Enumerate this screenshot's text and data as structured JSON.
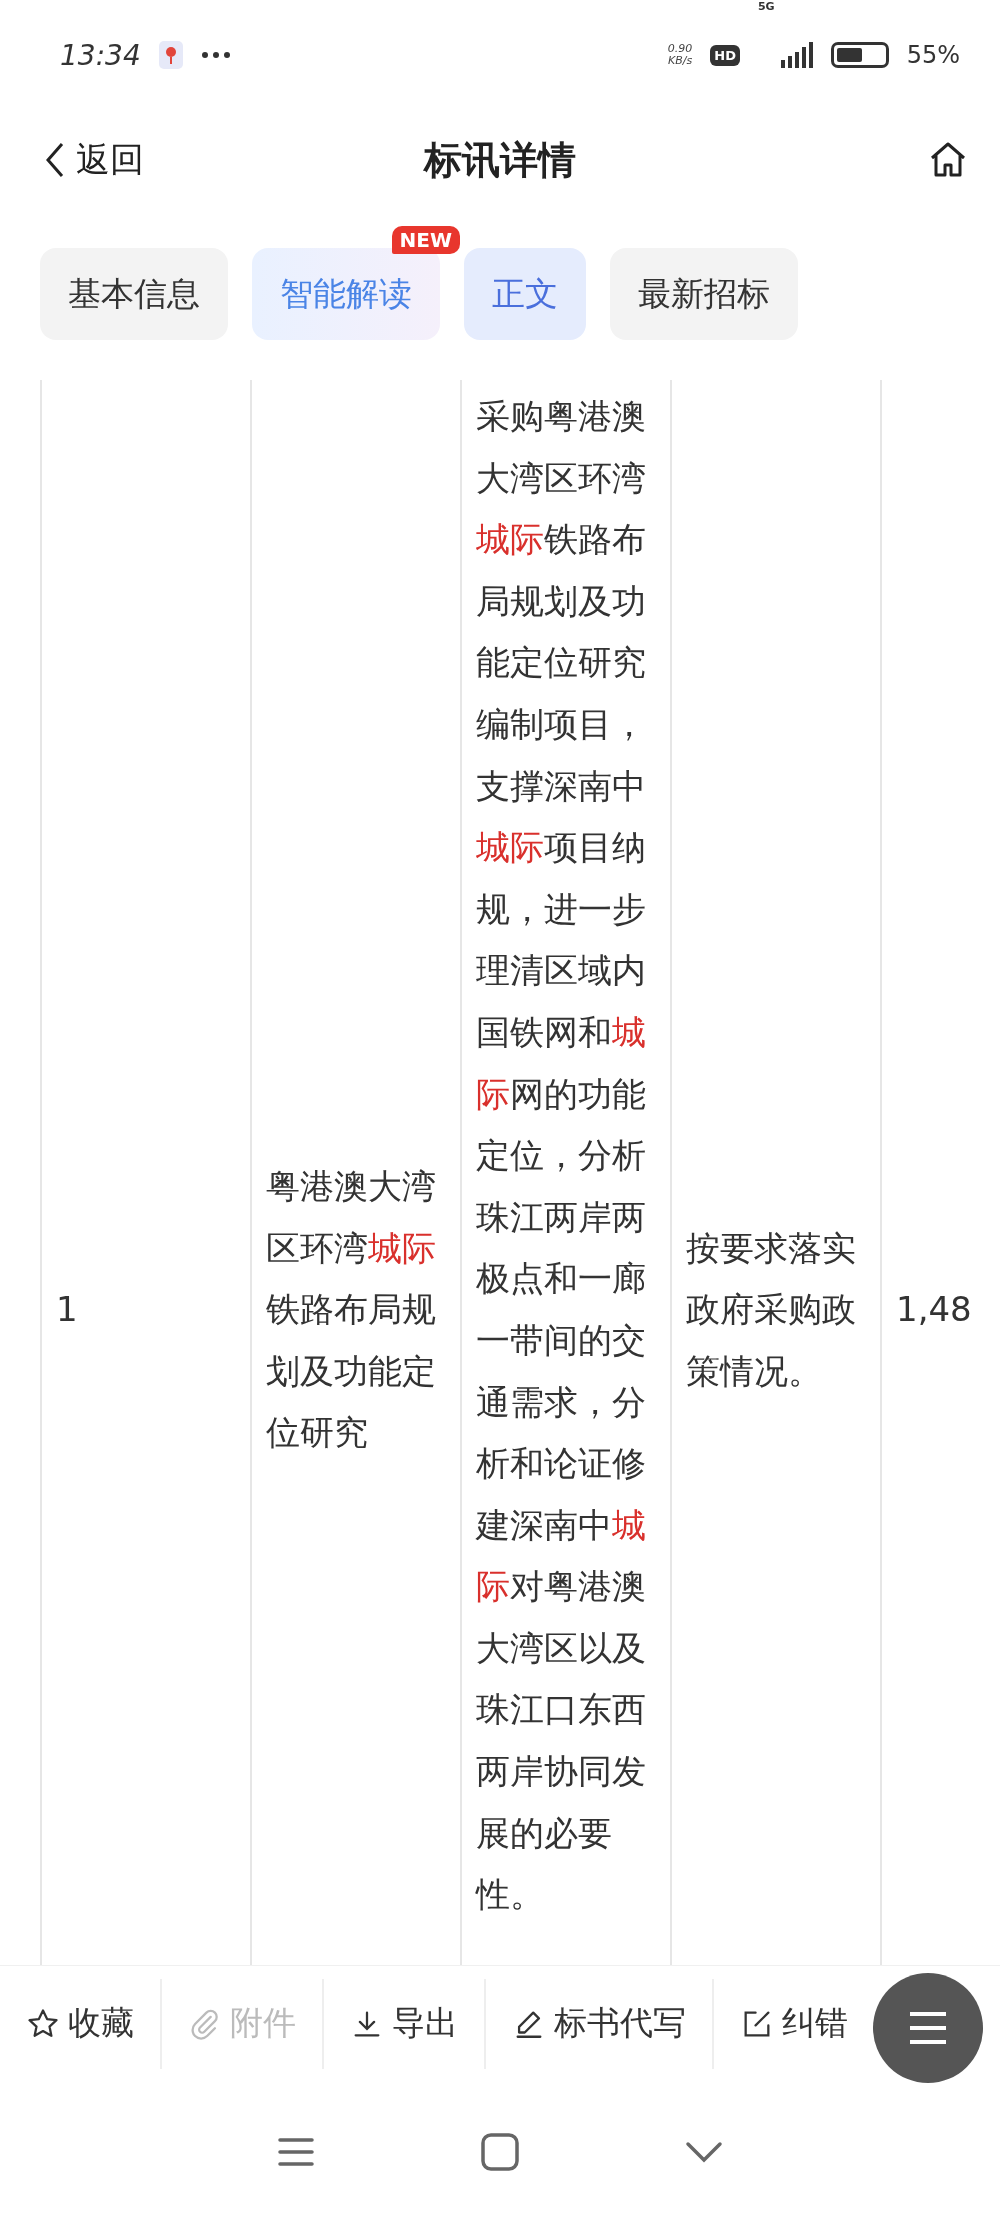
{
  "status_bar": {
    "time": "13:34",
    "speed": "0.90",
    "speed_unit": "KB/s",
    "hd": "HD",
    "network": "5G",
    "battery": "55%"
  },
  "header": {
    "back": "返回",
    "title": "标讯详情"
  },
  "tabs": [
    {
      "label": "基本信息",
      "selected": false,
      "kind": "plain"
    },
    {
      "label": "智能解读",
      "selected": false,
      "kind": "ai",
      "badge": "NEW"
    },
    {
      "label": "正文",
      "selected": true,
      "kind": "plain"
    },
    {
      "label": "最新招标",
      "selected": false,
      "kind": "plain"
    }
  ],
  "table": {
    "rows": [
      {
        "cells": [
          {
            "segments": [
              {
                "text": "1",
                "highlight": false
              }
            ]
          },
          {
            "segments": [
              {
                "text": "粤港澳大湾区环湾",
                "highlight": false
              },
              {
                "text": "城际",
                "highlight": true
              },
              {
                "text": "铁路布局规划及功能定位研究",
                "highlight": false
              }
            ]
          },
          {
            "segments": [
              {
                "text": "采购粤港澳大湾区环湾",
                "highlight": false
              },
              {
                "text": "城际",
                "highlight": true
              },
              {
                "text": "铁路布局规划及功能定位研究编制项目，支撑深南中",
                "highlight": false
              },
              {
                "text": "城际",
                "highlight": true
              },
              {
                "text": "项目纳规，进一步理清区域内国铁网和",
                "highlight": false
              },
              {
                "text": "城际",
                "highlight": true
              },
              {
                "text": "网的功能定位，分析珠江两岸两极点和一廊一带间的交通需求，分析和论证修建深南中",
                "highlight": false
              },
              {
                "text": "城际",
                "highlight": true
              },
              {
                "text": "对粤港澳大湾区以及珠江口东西两岸协同发展的必要性。",
                "highlight": false
              }
            ]
          },
          {
            "segments": [
              {
                "text": "按要求落实政府采购政策情况。",
                "highlight": false
              }
            ]
          },
          {
            "segments": [
              {
                "text": "1,48",
                "highlight": false
              }
            ]
          }
        ]
      }
    ]
  },
  "toolbar": [
    {
      "label": "收藏",
      "kind": "star",
      "disabled": false
    },
    {
      "label": "附件",
      "kind": "clip",
      "disabled": true
    },
    {
      "label": "导出",
      "kind": "download",
      "disabled": false
    },
    {
      "label": "标书代写",
      "kind": "pen",
      "disabled": false
    },
    {
      "label": "纠错",
      "kind": "edit",
      "disabled": false
    }
  ]
}
